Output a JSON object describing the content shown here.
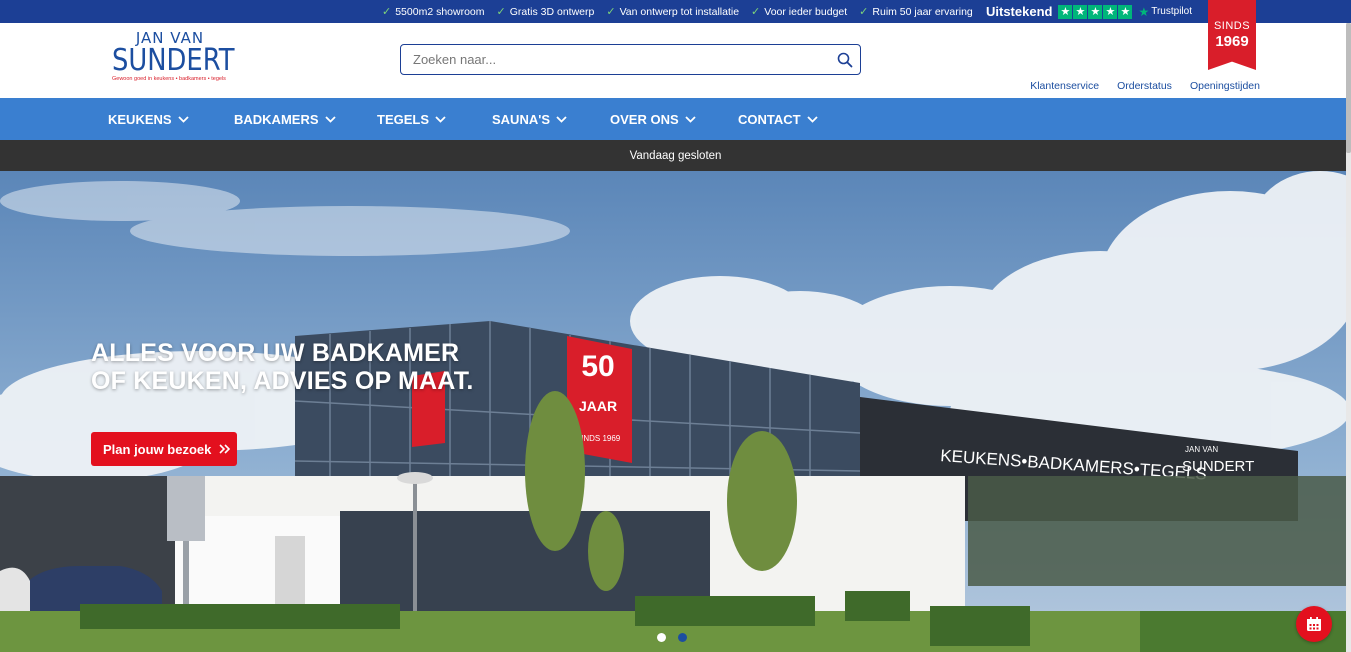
{
  "topbar": {
    "usps": [
      "5500m2 showroom",
      "Gratis 3D ontwerp",
      "Van ontwerp tot installatie",
      "Voor ieder budget",
      "Ruim 50 jaar ervaring"
    ],
    "trustpilot_rating": "Uitstekend",
    "trustpilot_label": "Trustpilot",
    "stars": 5
  },
  "ribbon": {
    "line1": "SINDS",
    "line2": "1969"
  },
  "logo": {
    "line1": "JAN VAN",
    "line2": "SUNDERT",
    "tagline": "Gewoon goed in keukens • badkamers • tegels"
  },
  "search": {
    "placeholder": "Zoeken naar..."
  },
  "header_links": [
    "Klantenservice",
    "Orderstatus",
    "Openingstijden"
  ],
  "nav": [
    "KEUKENS",
    "BADKAMERS",
    "TEGELS",
    "SAUNA'S",
    "OVER ONS",
    "CONTACT"
  ],
  "notice": "Vandaag gesloten",
  "hero": {
    "title": "ALLES VOOR UW BADKAMER OF KEUKEN, ADVIES OP MAAT.",
    "button_label": "Plan jouw bezoek",
    "banner_text_1": "50",
    "banner_text_2": "JAAR",
    "banner_text_3": "SINDS 1969",
    "facade_text": "KEUKENS•BADKAMERS•TEGELS",
    "facade_logo_1": "JAN VAN",
    "facade_logo_2": "SUNDERT",
    "slides_total": 2,
    "slide_active": 2
  },
  "colors": {
    "topbar": "#1c3f95",
    "nav": "#3a7fd0",
    "notice": "#333333",
    "accent": "#e3101e",
    "trustpilot": "#00b67a"
  },
  "icons": {
    "search": "search-icon",
    "chevron": "chevron-down-icon",
    "check": "check-icon",
    "calendar": "calendar-icon",
    "arrow": "double-chevron-right-icon"
  }
}
